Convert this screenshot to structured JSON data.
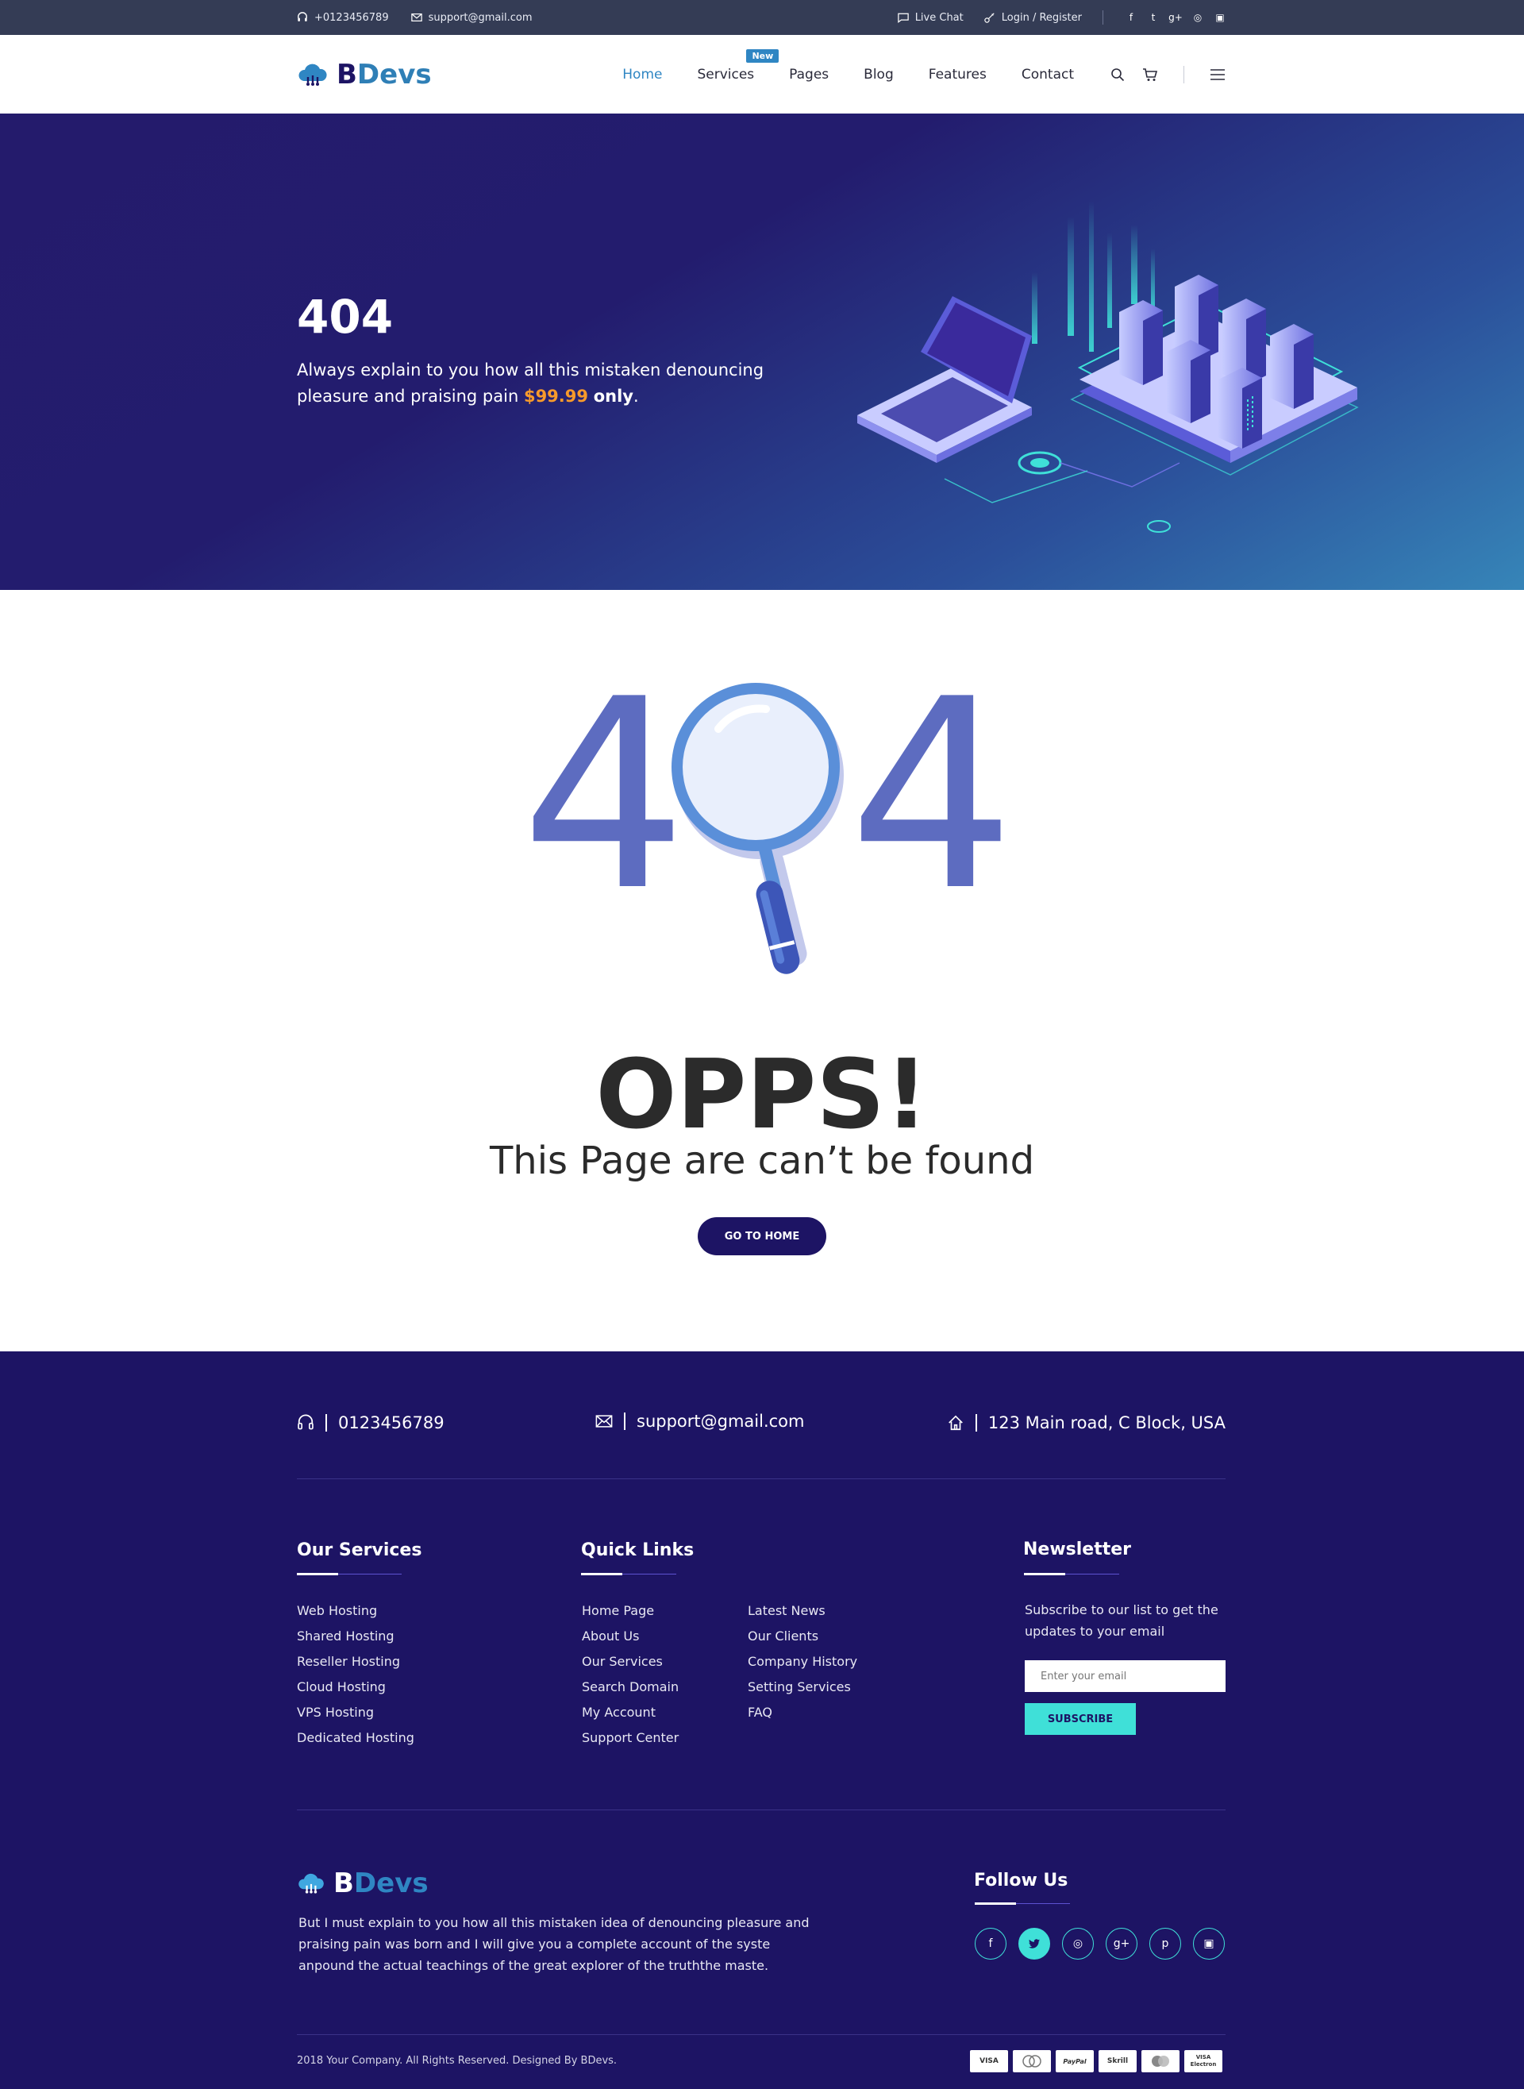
{
  "topbar": {
    "phone": "+0123456789",
    "email": "support@gmail.com",
    "live_chat": "Live Chat",
    "login": "Login / Register",
    "socials": [
      "facebook-icon",
      "twitter-icon",
      "google-plus-icon",
      "dribbble-icon",
      "instagram-icon"
    ]
  },
  "header": {
    "logo_b": "B",
    "logo_devs": "Devs",
    "nav": [
      {
        "label": "Home",
        "active": true
      },
      {
        "label": "Services",
        "badge": "New"
      },
      {
        "label": "Pages"
      },
      {
        "label": "Blog"
      },
      {
        "label": "Features"
      },
      {
        "label": "Contact"
      }
    ]
  },
  "hero": {
    "title": "404",
    "text": "Always explain to you how all this mistaken denouncing pleasure and praising pain",
    "price": "$99.99",
    "only": "only",
    "end": "."
  },
  "error": {
    "digit_left": "4",
    "digit_right": "4",
    "headline": "OPPS!",
    "subline": "This Page are can’t be found",
    "button": "GO TO HOME"
  },
  "footer": {
    "phone": "0123456789",
    "email": "support@gmail.com",
    "address": "123 Main road, C Block, USA",
    "services_title": "Our Services",
    "services": [
      "Web Hosting",
      "Shared Hosting",
      "Reseller Hosting",
      "Cloud Hosting",
      "VPS Hosting",
      "Dedicated Hosting"
    ],
    "links_title": "Quick Links",
    "links_col1": [
      "Home Page",
      "About Us",
      "Our Services",
      "Search Domain",
      "My Account",
      "Support Center"
    ],
    "links_col2": [
      "Latest News",
      "Our Clients",
      "Company History",
      "Setting Services",
      "FAQ"
    ],
    "newsletter_title": "Newsletter",
    "newsletter_text": "Subscribe to our list to get the updates to your email",
    "email_placeholder": "Enter your email",
    "subscribe": "SUBSCRIBE",
    "about": "But I must explain to you how all this mistaken idea of denouncing pleasure and praising pain was born and I will give you a complete account of the syste anpound the actual teachings of the great explorer of the truththe maste.",
    "follow_title": "Follow Us",
    "follow_icons": [
      "facebook-icon",
      "twitter-icon",
      "dribbble-icon",
      "google-plus-icon",
      "pinterest-icon",
      "instagram-icon"
    ],
    "copyright": "2018 Your Company. All Rights Reserved. Designed By BDevs.",
    "cards": [
      "VISA",
      "Maestro",
      "PayPal",
      "Skrill",
      "MasterCard",
      "VISA Electron"
    ]
  }
}
